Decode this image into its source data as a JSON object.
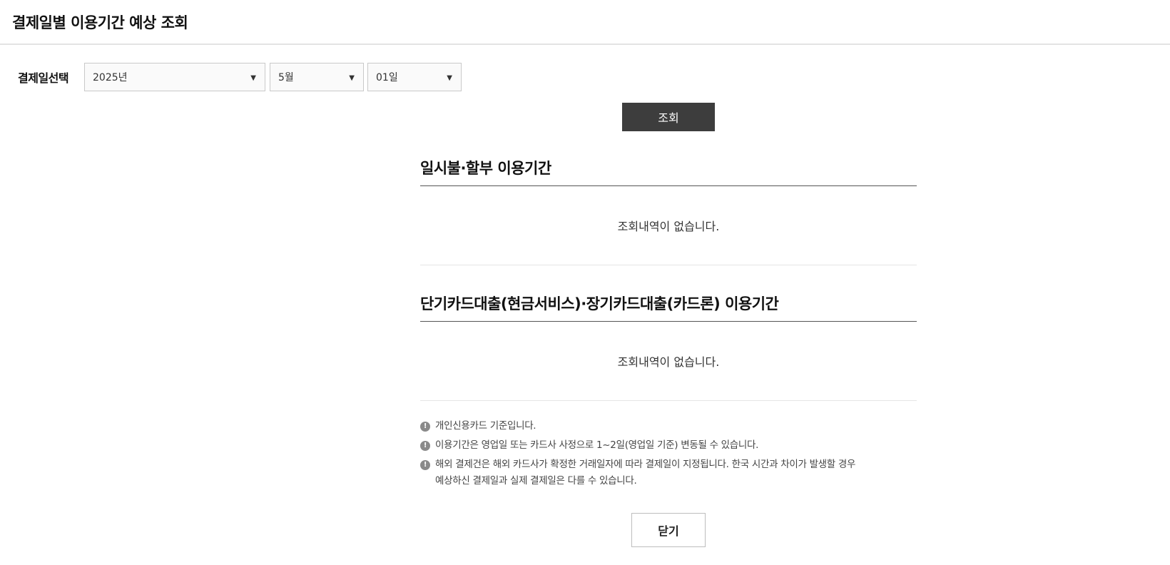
{
  "header": {
    "title": "결제일별 이용기간 예상 조회"
  },
  "date_select": {
    "label": "결제일선택",
    "year": "2025년",
    "month": "5월",
    "day": "01일",
    "caret": "▼"
  },
  "search_button": "조회",
  "sections": [
    {
      "title": "일시불·할부 이용기간",
      "empty_text": "조회내역이 없습니다."
    },
    {
      "title": "단기카드대출(현금서비스)·장기카드대출(카드론) 이용기간",
      "empty_text": "조회내역이 없습니다."
    }
  ],
  "notes": {
    "icon": "!",
    "items": [
      {
        "line1": "개인신용카드 기준입니다.",
        "line2": ""
      },
      {
        "line1": "이용기간은 영업일 또는 카드사 사정으로 1~2일(영업일 기준) 변동될 수 있습니다.",
        "line2": ""
      },
      {
        "line1": "해외 결제건은 해외 카드사가 확정한 거래일자에 따라 결제일이 지정됩니다. 한국 시간과 차이가 발생할 경우",
        "line2": "예상하신 결제일과 실제 결제일은 다를 수 있습니다."
      }
    ]
  },
  "close_button": "닫기"
}
